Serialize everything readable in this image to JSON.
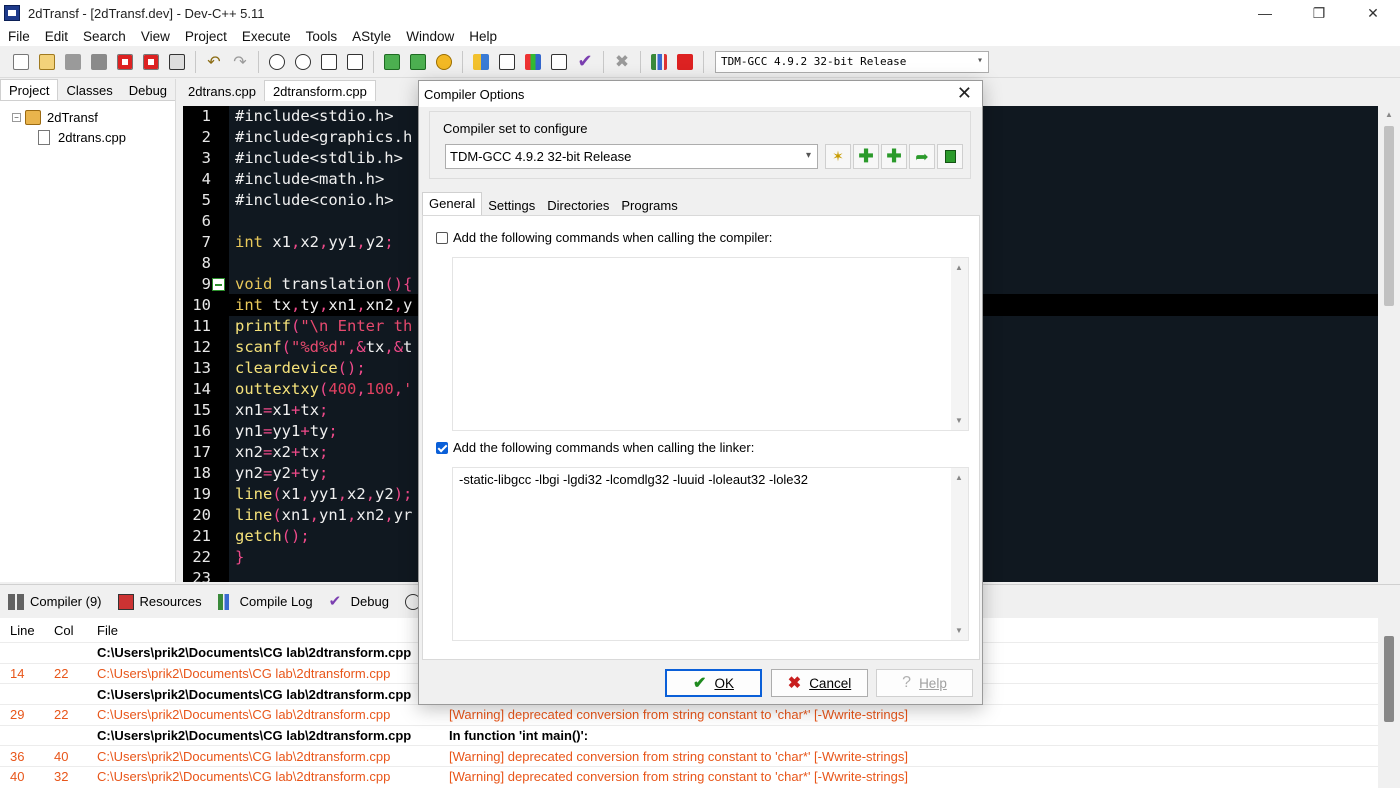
{
  "window": {
    "title": "2dTransf - [2dTransf.dev] - Dev-C++ 5.11",
    "minimize": "—",
    "maximize": "❐",
    "close": "✕"
  },
  "menu": [
    "File",
    "Edit",
    "Search",
    "View",
    "Project",
    "Execute",
    "Tools",
    "AStyle",
    "Window",
    "Help"
  ],
  "toolbar": {
    "compiler_select": "TDM-GCC 4.9.2 32-bit Release"
  },
  "left_panel": {
    "tabs": [
      "Project",
      "Classes",
      "Debug"
    ],
    "project_name": "2dTransf",
    "files": [
      "2dtrans.cpp"
    ]
  },
  "editor": {
    "tabs": [
      "2dtrans.cpp",
      "2dtransform.cpp"
    ],
    "line_numbers": [
      "1",
      "2",
      "3",
      "4",
      "5",
      "6",
      "7",
      "8",
      "9",
      "10",
      "11",
      "12",
      "13",
      "14",
      "15",
      "16",
      "17",
      "18",
      "19",
      "20",
      "21",
      "22",
      "23"
    ]
  },
  "bottom": {
    "tabs": [
      "Compiler (9)",
      "Resources",
      "Compile Log",
      "Debug"
    ],
    "columns": [
      "Line",
      "Col",
      "File"
    ],
    "rows": [
      {
        "line": "",
        "col": "",
        "file": "C:\\Users\\prik2\\Documents\\CG lab\\2dtransform.cpp",
        "msg": "",
        "style": "bold"
      },
      {
        "line": "14",
        "col": "22",
        "file": "C:\\Users\\prik2\\Documents\\CG lab\\2dtransform.cpp",
        "msg": "",
        "style": "warn"
      },
      {
        "line": "",
        "col": "",
        "file": "C:\\Users\\prik2\\Documents\\CG lab\\2dtransform.cpp",
        "msg": "",
        "style": "bold"
      },
      {
        "line": "29",
        "col": "22",
        "file": "C:\\Users\\prik2\\Documents\\CG lab\\2dtransform.cpp",
        "msg": "[Warning] deprecated conversion from string constant to 'char*' [-Wwrite-strings]",
        "style": "warn"
      },
      {
        "line": "",
        "col": "",
        "file": "C:\\Users\\prik2\\Documents\\CG lab\\2dtransform.cpp",
        "msg": "In function 'int main()':",
        "style": "bold"
      },
      {
        "line": "36",
        "col": "40",
        "file": "C:\\Users\\prik2\\Documents\\CG lab\\2dtransform.cpp",
        "msg": "[Warning] deprecated conversion from string constant to 'char*' [-Wwrite-strings]",
        "style": "warn"
      },
      {
        "line": "40",
        "col": "32",
        "file": "C:\\Users\\prik2\\Documents\\CG lab\\2dtransform.cpp",
        "msg": "[Warning] deprecated conversion from string constant to 'char*' [-Wwrite-strings]",
        "style": "warn"
      }
    ]
  },
  "dialog": {
    "title": "Compiler Options",
    "group_label": "Compiler set to configure",
    "compiler_set": "TDM-GCC 4.9.2 32-bit Release",
    "tabs": [
      "General",
      "Settings",
      "Directories",
      "Programs"
    ],
    "compiler_cmd_label": "Add the following commands when calling the compiler:",
    "compiler_cmd_value": "",
    "linker_cmd_label": "Add the following commands when calling the linker:",
    "linker_cmd_value": "-static-libgcc -lbgi -lgdi32 -lcomdlg32 -luuid -loleaut32 -lole32",
    "ok": "OK",
    "cancel": "Cancel",
    "help": "Help"
  }
}
